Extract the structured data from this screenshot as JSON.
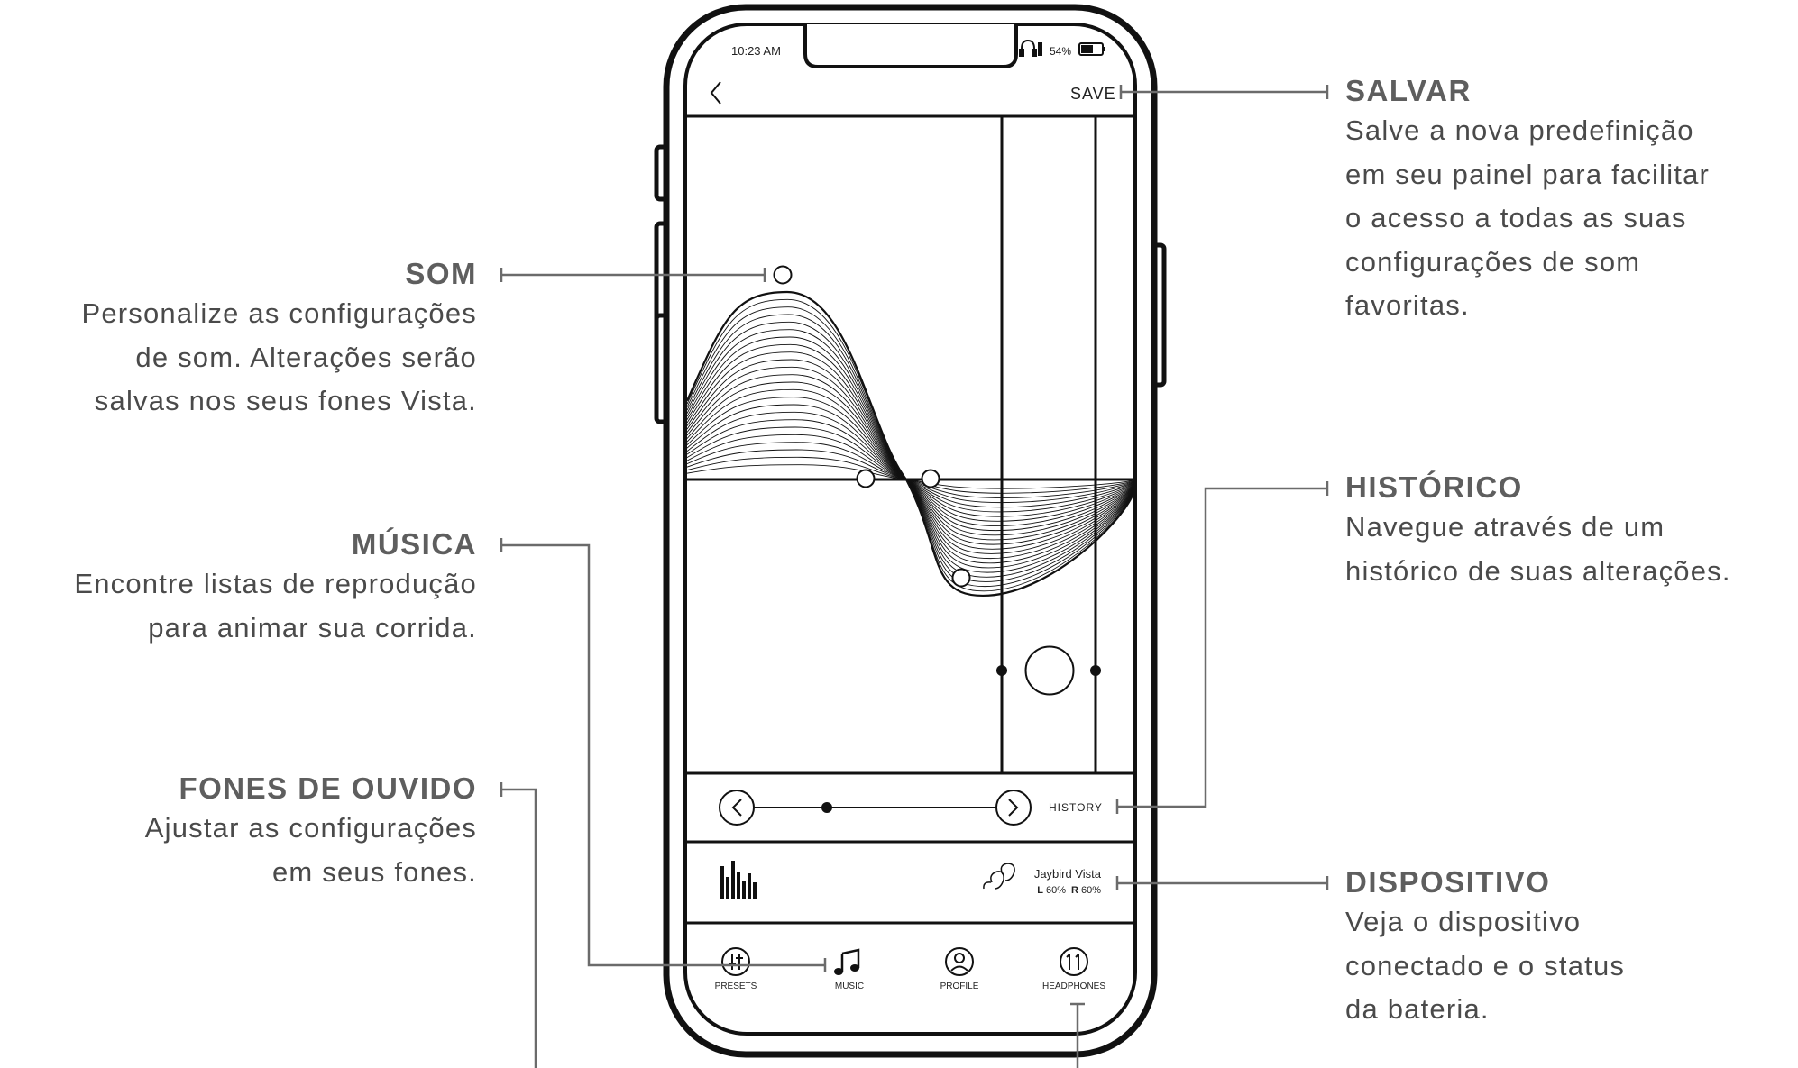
{
  "status_bar": {
    "time": "10:23 AM",
    "battery": "54%"
  },
  "header": {
    "save_label": "SAVE"
  },
  "history_label": "HISTORY",
  "device": {
    "name": "Jaybird Vista",
    "left_label": "L",
    "left_value": "60%",
    "right_label": "R",
    "right_value": "60%"
  },
  "nav": [
    {
      "label": "PRESETS",
      "icon": "presets-icon"
    },
    {
      "label": "MUSIC",
      "icon": "music-note-icon"
    },
    {
      "label": "PROFILE",
      "icon": "profile-icon"
    },
    {
      "label": "HEADPHONES",
      "icon": "headphones-icon"
    }
  ],
  "callouts": {
    "som": {
      "title": "SOM",
      "body": "Personalize as configurações\nde som. Alterações serão\nsalvas nos seus fones Vista."
    },
    "musica": {
      "title": "MÚSICA",
      "body": "Encontre listas de reprodução\npara animar sua corrida."
    },
    "fones": {
      "title": "FONES DE OUVIDO",
      "body": "Ajustar as configurações\nem seus fones."
    },
    "salvar": {
      "title": "SALVAR",
      "body": "Salve a nova predefinição\nem seu painel para facilitar\no acesso a todas as suas\nconfigurações de som\nfavoritas."
    },
    "historico": {
      "title": "HISTÓRICO",
      "body": "Navegue através de um\nhistórico de suas alterações."
    },
    "dispositivo": {
      "title": "DISPOSITIVO",
      "body": "Veja o dispositivo\nconectado e o status\nda bateria."
    }
  },
  "colors": {
    "ink": "#1a1a1a",
    "callout_text": "#4a4a4a",
    "leader": "#6b6b6b"
  }
}
